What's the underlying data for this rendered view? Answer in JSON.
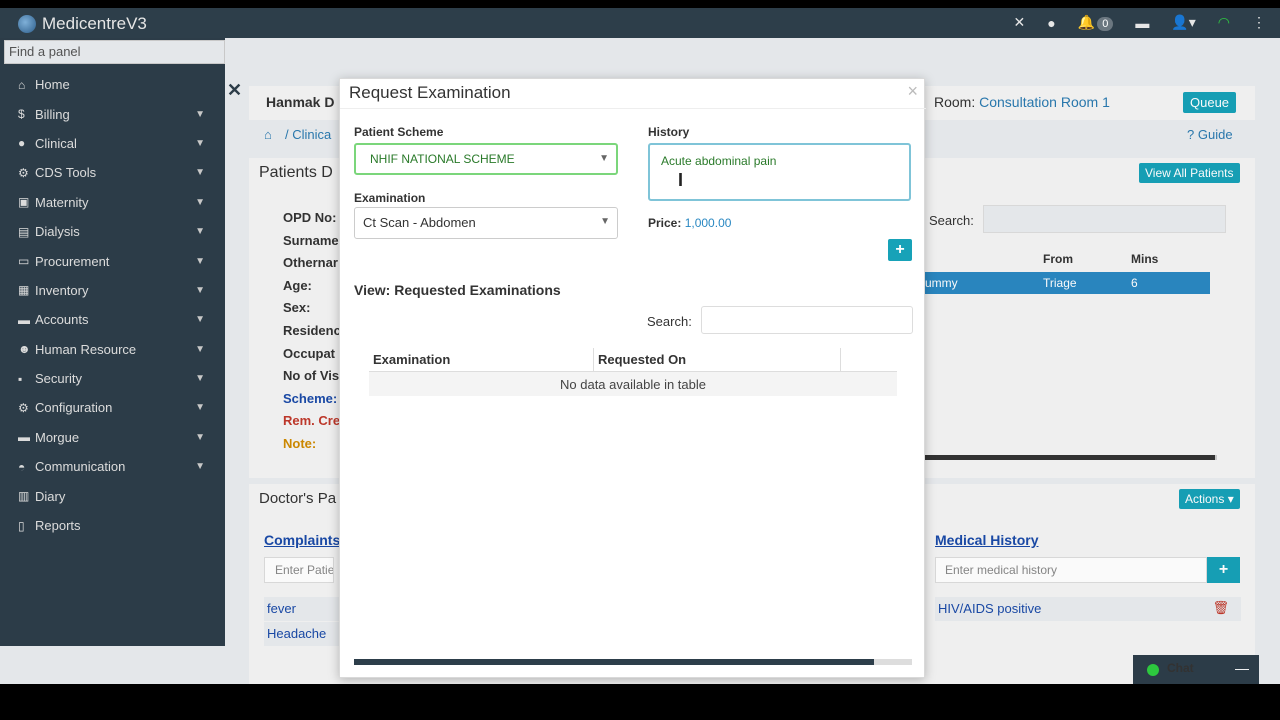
{
  "app": {
    "title": "MedicentreV3",
    "notification_count": "0"
  },
  "sidebar": {
    "search_placeholder": "Find a panel",
    "items": [
      {
        "label": "Home",
        "icon": "home-icon"
      },
      {
        "label": "Billing",
        "icon": "dollar-icon"
      },
      {
        "label": "Clinical",
        "icon": "user-icon"
      },
      {
        "label": "CDS Tools",
        "icon": "tools-icon"
      },
      {
        "label": "Maternity",
        "icon": "maternity-icon"
      },
      {
        "label": "Dialysis",
        "icon": "dialysis-icon"
      },
      {
        "label": "Procurement",
        "icon": "procurement-icon"
      },
      {
        "label": "Inventory",
        "icon": "inventory-icon"
      },
      {
        "label": "Accounts",
        "icon": "accounts-icon"
      },
      {
        "label": "Human Resource",
        "icon": "users-icon"
      },
      {
        "label": "Security",
        "icon": "lock-icon"
      },
      {
        "label": "Configuration",
        "icon": "cogs-icon"
      },
      {
        "label": "Morgue",
        "icon": "morgue-icon"
      },
      {
        "label": "Communication",
        "icon": "comments-icon"
      },
      {
        "label": "Diary",
        "icon": "book-icon"
      },
      {
        "label": "Reports",
        "icon": "file-icon"
      }
    ]
  },
  "page": {
    "patient_header": "Hanmak D",
    "room_label": "Room:",
    "room_name": "Consultation Room 1",
    "queue_label": "Queue",
    "breadcrumb": "Clinica",
    "guide_label": "Guide",
    "patients_panel_title": "Patients D",
    "view_all_label": "View All Patients",
    "search_label": "Search:",
    "fields": [
      "OPD No:",
      "Surname",
      "Othernar",
      "Age:",
      "Sex:",
      "Residenc",
      "Occupat",
      "No of Vis",
      "Scheme:",
      "Rem. Cre",
      "Note:"
    ],
    "table_headers": [
      "From",
      "Mins"
    ],
    "table_row": {
      "name": "ummy",
      "from": "Triage",
      "mins": "6"
    },
    "doctors_panel_title": "Doctor's Pa",
    "actions_label": "Actions",
    "complaints_title": "Complaints",
    "complaints_placeholder": "Enter Patien",
    "complaints": [
      "fever",
      "Headache"
    ],
    "medical_history_title": "Medical History",
    "medical_history_placeholder": "Enter medical history",
    "medical_history_items": [
      "HIV/AIDS positive"
    ],
    "chat_label": "Chat"
  },
  "modal": {
    "title": "Request Examination",
    "close": "×",
    "patient_scheme_label": "Patient Scheme",
    "patient_scheme_value": "NHIF NATIONAL SCHEME",
    "history_label": "History",
    "history_value": "Acute abdominal pain",
    "examination_label": "Examination",
    "examination_value": "Ct Scan - Abdomen",
    "price_label": "Price:",
    "price_value": "1,000.00",
    "requested_title": "View: Requested Examinations",
    "search_label": "Search:",
    "table_headers": [
      "Examination",
      "Requested On",
      ""
    ],
    "empty_message": "No data available in table"
  }
}
